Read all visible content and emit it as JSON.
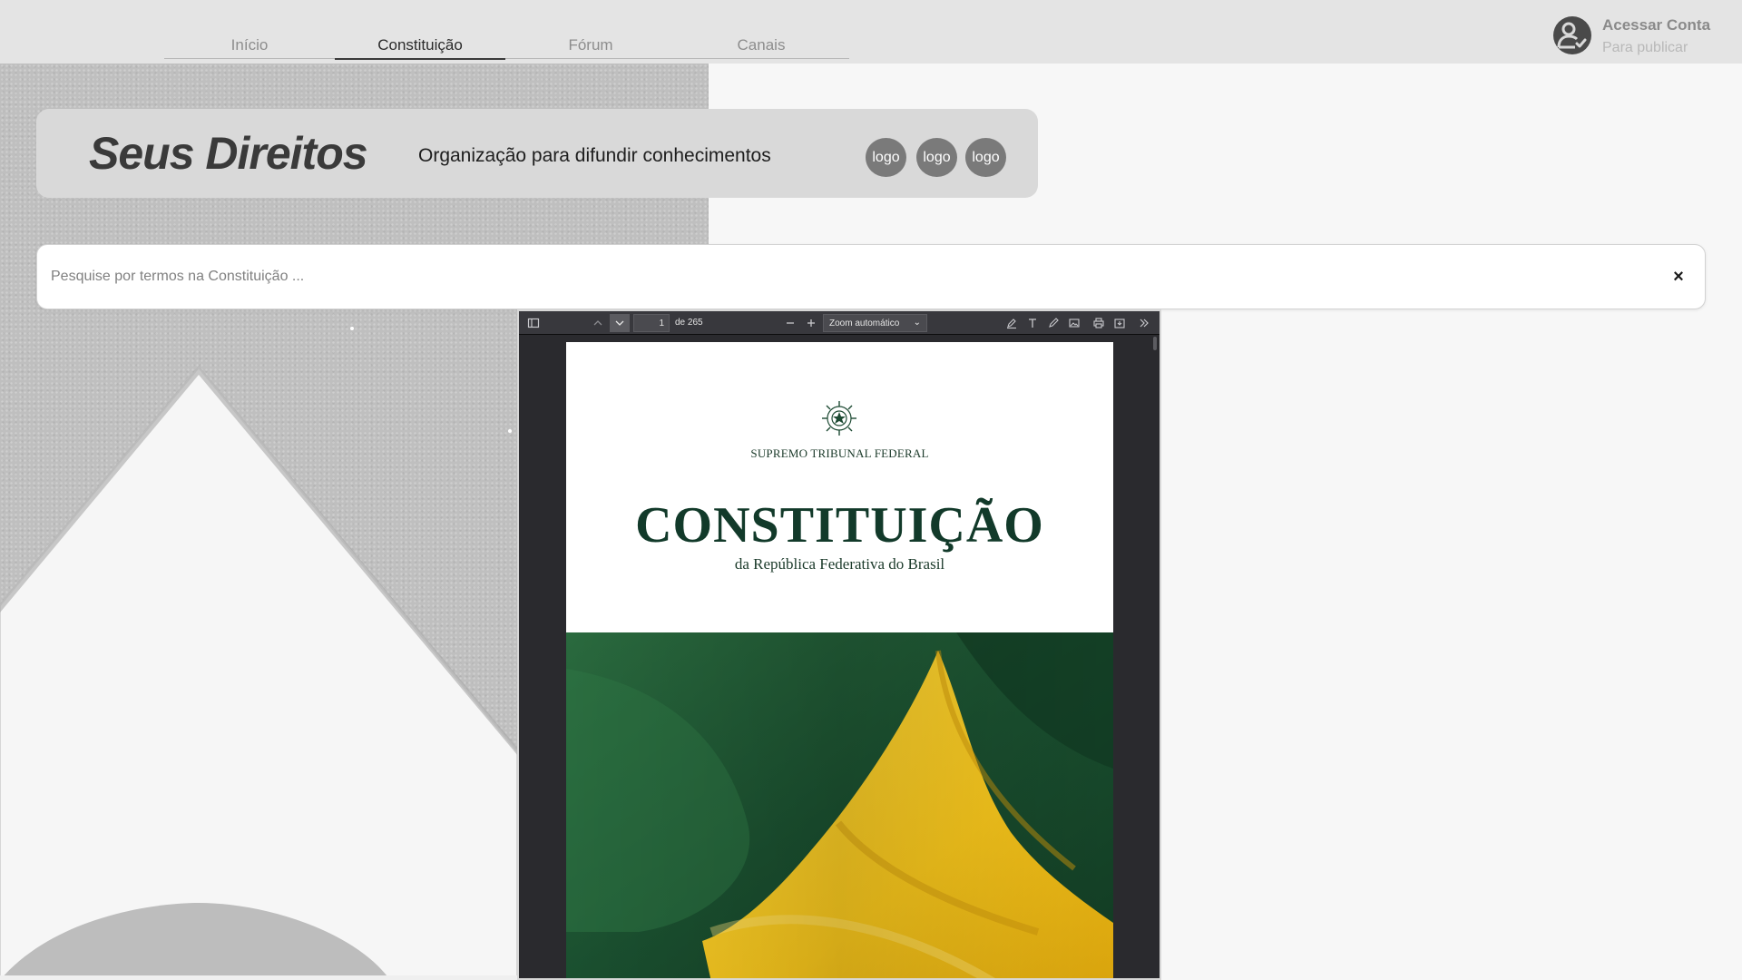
{
  "nav": {
    "items": [
      {
        "label": "Início"
      },
      {
        "label": "Constituição"
      },
      {
        "label": "Fórum"
      },
      {
        "label": "Canais"
      }
    ],
    "active_index": 1
  },
  "account": {
    "title": "Acessar Conta",
    "subtitle": "Para publicar",
    "icon": "user-check-icon"
  },
  "banner": {
    "title": "Seus Direitos",
    "subtitle": "Organização para difundir conhecimentos",
    "logos": [
      "logo",
      "logo",
      "logo"
    ]
  },
  "search": {
    "placeholder": "Pesquise por termos na Constituição ...",
    "value": "",
    "clear_label": "×"
  },
  "pdf_viewer": {
    "current_page": "1",
    "total_pages": "de 265",
    "zoom": "Zoom automático",
    "toolbar_icons": [
      "sidebar-toggle-icon",
      "previous-page-icon",
      "next-page-icon",
      "zoom-out-icon",
      "zoom-in-icon",
      "highlight-icon",
      "text-icon",
      "draw-icon",
      "image-icon",
      "print-icon",
      "save-icon",
      "more-tools-icon"
    ],
    "page": {
      "institution": "SUPREMO TRIBUNAL FEDERAL",
      "title": "CONSTITUIÇÃO",
      "subtitle": "da República Federativa do Brasil"
    }
  },
  "colors": {
    "header_bg": "#e4e4e4",
    "banner_bg": "#d9d9d9",
    "viewer_bg": "#2a2a2e",
    "flag_green": "#1f5a35",
    "flag_yellow": "#f2c21b",
    "title_green": "#123a2a"
  }
}
